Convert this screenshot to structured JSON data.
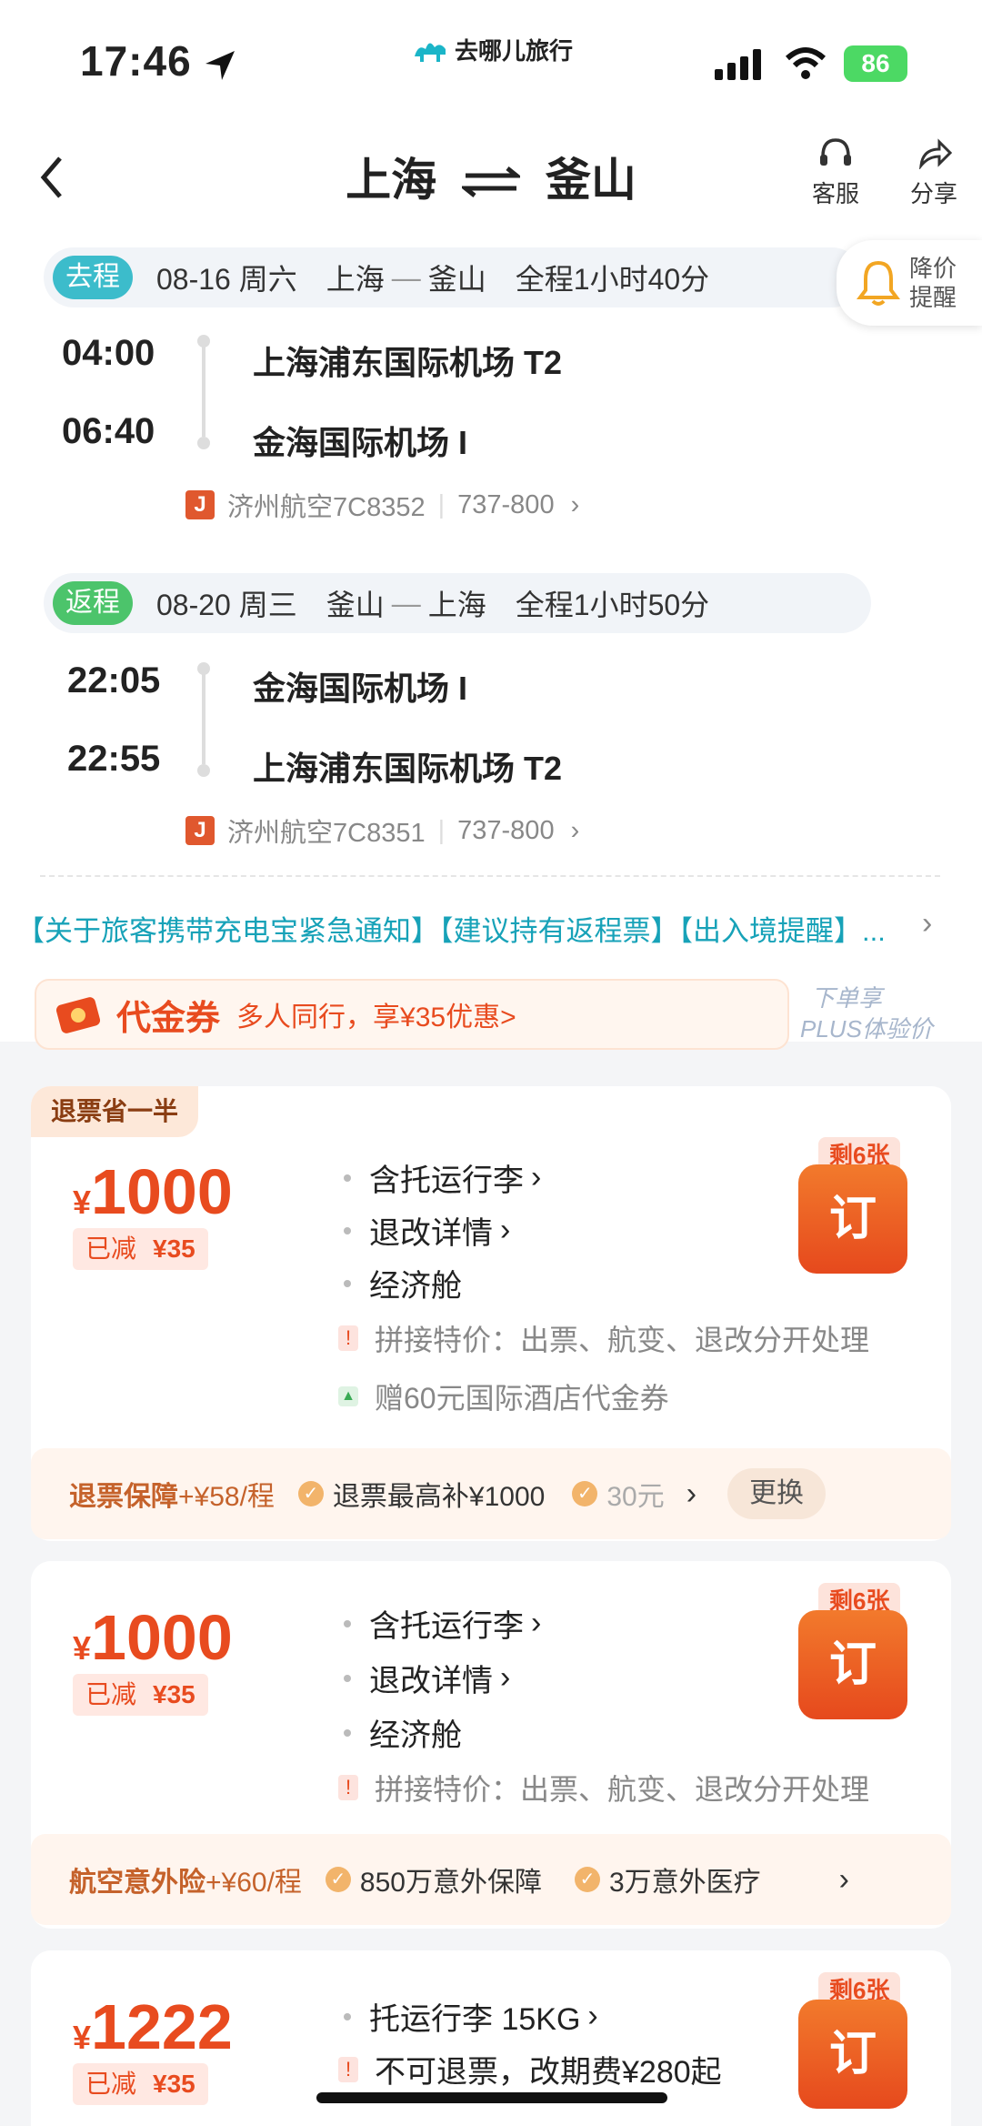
{
  "status": {
    "time": "17:46",
    "brand": "去哪儿旅行",
    "battery": "86"
  },
  "header": {
    "title_from": "上海",
    "title_to": "釜山",
    "service": "客服",
    "share": "分享",
    "price_alert_1": "降价",
    "price_alert_2": "提醒"
  },
  "outbound": {
    "tag": "去程",
    "date": "08-16 周六",
    "from": "上海",
    "to": "釜山",
    "duration": "全程1小时40分",
    "dep_time": "04:00",
    "dep_airport": "上海浦东国际机场 T2",
    "arr_time": "06:40",
    "arr_airport": "金海国际机场 I",
    "airline": "济州航空7C8352",
    "aircraft": "737-800"
  },
  "inbound": {
    "tag": "返程",
    "date": "08-20 周三",
    "from": "釜山",
    "to": "上海",
    "duration": "全程1小时50分",
    "dep_time": "22:05",
    "dep_airport": "金海国际机场 I",
    "arr_time": "22:55",
    "arr_airport": "上海浦东国际机场 T2",
    "airline": "济州航空7C8351",
    "aircraft": "737-800"
  },
  "notice": "【关于旅客携带充电宝紧急通知】【建议持有返程票】【出入境提醒】...",
  "voucher": {
    "title": "代金券",
    "desc": "多人同行，享¥35优惠>",
    "plus_1": "下单享",
    "plus_2": "PLUS体验价"
  },
  "cards": [
    {
      "badge": "退票省一半",
      "currency": "¥",
      "price": "1000",
      "reduced_label": "已减",
      "reduced": "¥35",
      "f1": "含托运行李",
      "f2": "退改详情",
      "f3": "经济舱",
      "special": "拼接特价：出票、航变、退改分开处理",
      "gift": "赠60元国际酒店代金券",
      "remain": "剩6张",
      "order": "订",
      "ins_name": "退票保障",
      "ins_price": "+¥58/程",
      "ins_item1": "退票最高补¥1000",
      "ins_item2": "30元",
      "ins_change": "更换"
    },
    {
      "currency": "¥",
      "price": "1000",
      "reduced_label": "已减",
      "reduced": "¥35",
      "f1": "含托运行李",
      "f2": "退改详情",
      "f3": "经济舱",
      "special": "拼接特价：出票、航变、退改分开处理",
      "remain": "剩6张",
      "order": "订",
      "ins_name": "航空意外险",
      "ins_price": "+¥60/程",
      "ins_item1": "850万意外保障",
      "ins_item2": "3万意外医疗"
    },
    {
      "currency": "¥",
      "price": "1222",
      "reduced_label": "已减",
      "reduced": "¥35",
      "f1": "托运行李 15KG",
      "f2": "不可退票，改期费¥280起",
      "remain": "剩6张",
      "order": "订"
    }
  ],
  "colors": {
    "accent": "#e84b1f",
    "teal": "#17a2b8",
    "tag_out": "#3cbccb",
    "tag_in": "#4cc46b"
  }
}
